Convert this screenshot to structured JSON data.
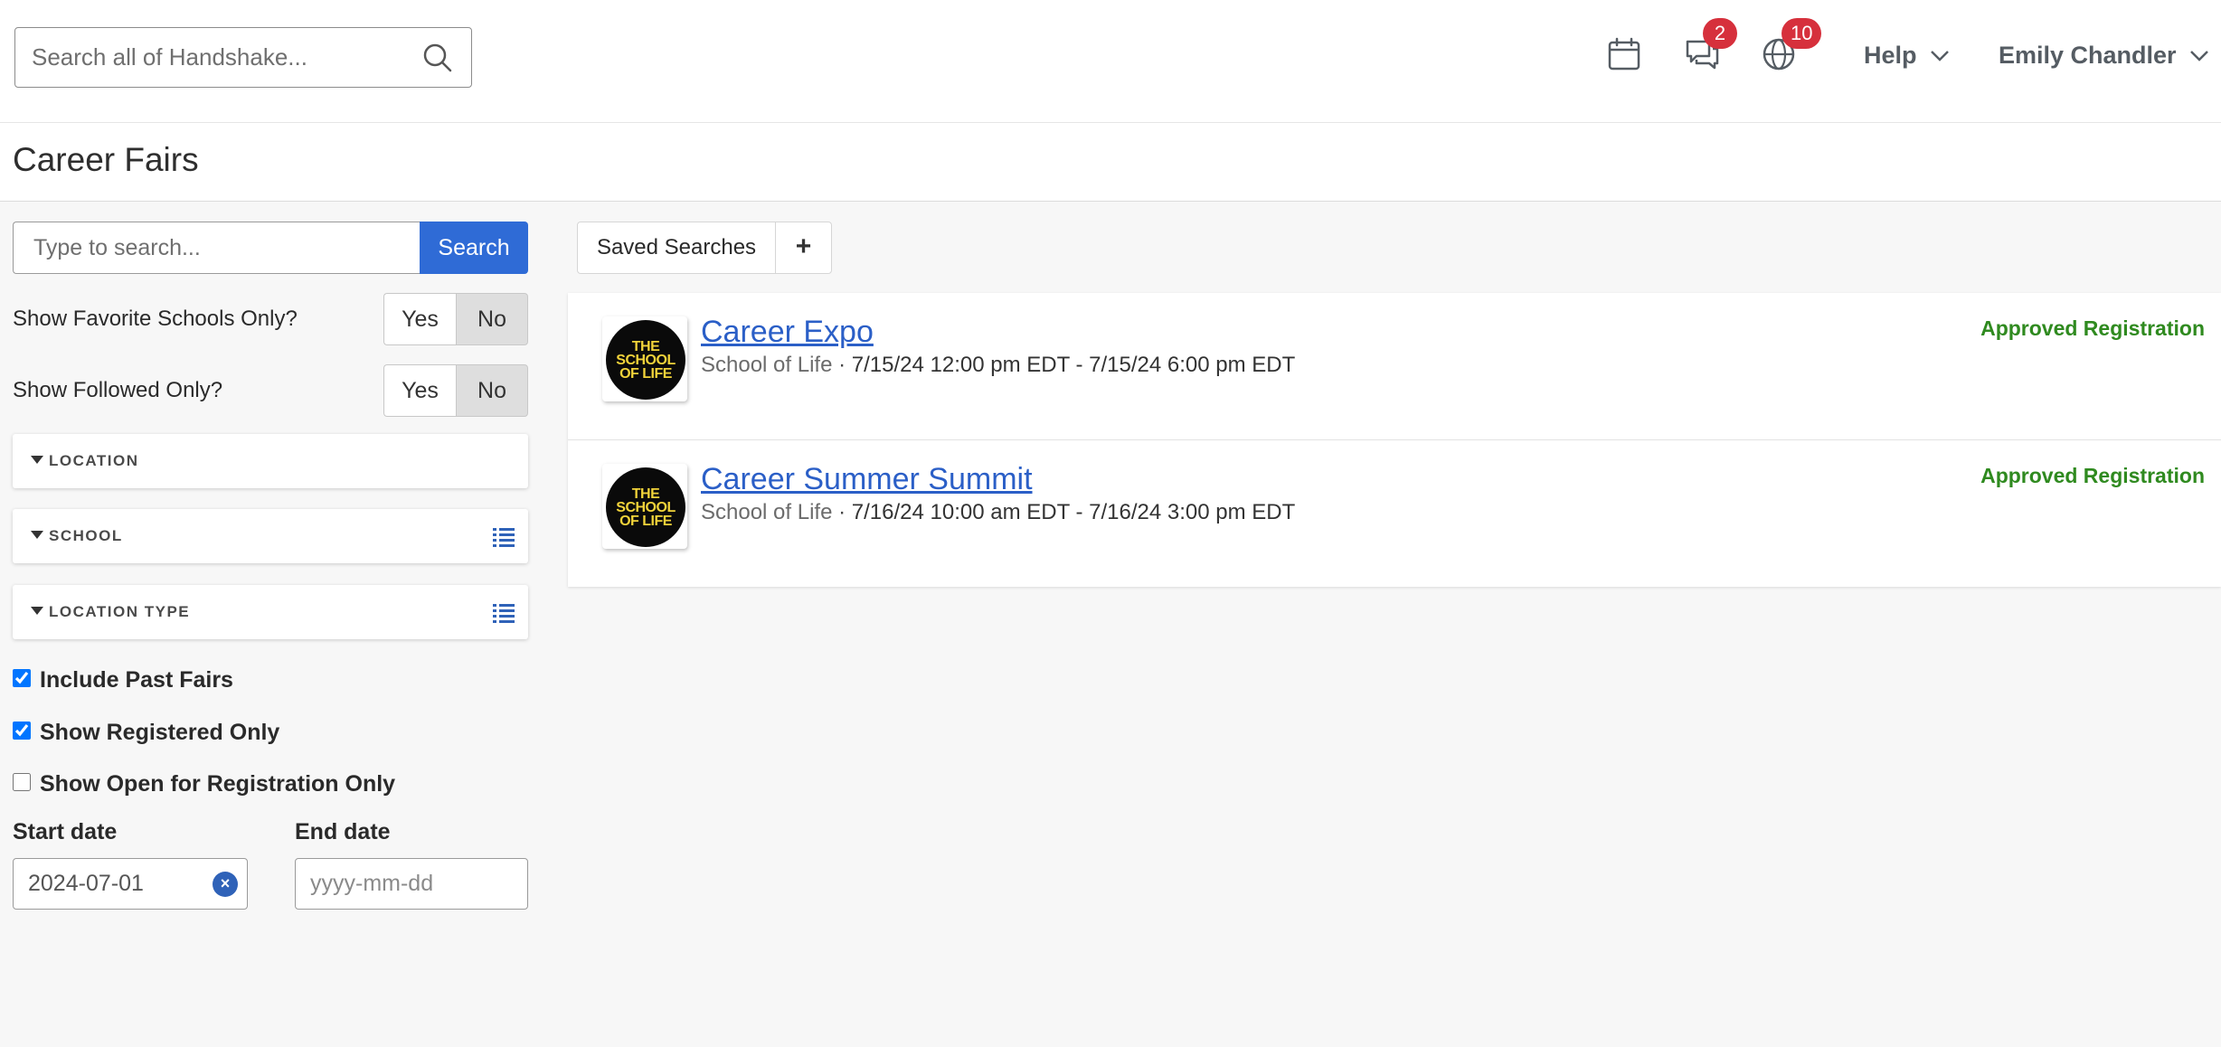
{
  "header": {
    "search_placeholder": "Search all of Handshake...",
    "messages_badge": "2",
    "notifications_badge": "10",
    "help_label": "Help",
    "user_name": "Emily Chandler"
  },
  "page": {
    "title": "Career Fairs"
  },
  "filters": {
    "search_placeholder": "Type to search...",
    "search_button": "Search",
    "favorite_schools": {
      "label": "Show Favorite Schools Only?",
      "yes": "Yes",
      "no": "No",
      "selected": "No"
    },
    "followed_only": {
      "label": "Show Followed Only?",
      "yes": "Yes",
      "no": "No",
      "selected": "No"
    },
    "accordions": [
      {
        "label": "LOCATION"
      },
      {
        "label": "SCHOOL"
      },
      {
        "label": "LOCATION TYPE"
      }
    ],
    "checkboxes": [
      {
        "label": "Include Past Fairs",
        "checked": true
      },
      {
        "label": "Show Registered Only",
        "checked": true
      },
      {
        "label": "Show Open for Registration Only",
        "checked": false
      }
    ],
    "start_date": {
      "label": "Start date",
      "value": "2024-07-01"
    },
    "end_date": {
      "label": "End date",
      "placeholder": "yyyy-mm-dd"
    }
  },
  "toolbar": {
    "saved_searches": "Saved Searches",
    "add_label": "+"
  },
  "fairs": [
    {
      "title": "Career Expo",
      "school": "School of Life",
      "separator": "·",
      "when": "7/15/24 12:00 pm EDT - 7/15/24 6:00 pm EDT",
      "status": "Approved Registration",
      "logo_lines": [
        "THE",
        "SCHOOL",
        "OF LIFE"
      ]
    },
    {
      "title": "Career Summer Summit",
      "school": "School of Life",
      "separator": "·",
      "when": "7/16/24 10:00 am EDT - 7/16/24 3:00 pm EDT",
      "status": "Approved Registration",
      "logo_lines": [
        "THE",
        "SCHOOL",
        "OF LIFE"
      ]
    }
  ],
  "colors": {
    "accent": "#2f6bd6",
    "badge": "#d6303c",
    "approved": "#2f8a1f",
    "link": "#2b5fc7"
  }
}
